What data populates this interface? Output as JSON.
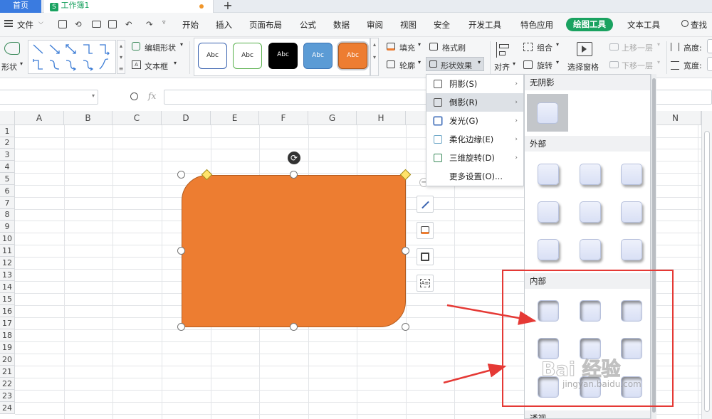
{
  "titlebar": {
    "home_tab": "首页",
    "doc_tab": "工作簿1",
    "doc_icon": "S",
    "new_tab": "+"
  },
  "menubar": {
    "file": "文件",
    "items": [
      "开始",
      "插入",
      "页面布局",
      "公式",
      "数据",
      "审阅",
      "视图",
      "安全",
      "开发工具",
      "特色应用",
      "绘图工具",
      "文本工具"
    ],
    "active": "绘图工具",
    "search": "查找"
  },
  "ribbon": {
    "shape_label": "形状",
    "edit_shape": "编辑形状",
    "text_box": "文本框",
    "styles": [
      "Abc",
      "Abc",
      "Abc",
      "Abc",
      "Abc"
    ],
    "fill": "填充",
    "format_brush": "格式刷",
    "outline": "轮廓",
    "shape_effects": "形状效果",
    "align": "对齐",
    "group": "组合",
    "rotate": "旋转",
    "selection_pane": "选择窗格",
    "bring_forward": "上移一层",
    "send_backward": "下移一层",
    "height": "高度:",
    "width": "宽度:"
  },
  "formulabar": {
    "fx": "fx"
  },
  "grid": {
    "columns": [
      "A",
      "B",
      "C",
      "D",
      "E",
      "F",
      "G",
      "H",
      "N"
    ],
    "rows": [
      "1",
      "2",
      "3",
      "4",
      "5",
      "6",
      "7",
      "8",
      "9",
      "10",
      "11",
      "12",
      "13",
      "14",
      "15",
      "16",
      "17",
      "18",
      "19",
      "20",
      "21",
      "22",
      "23",
      "24"
    ]
  },
  "effects_menu": {
    "items": [
      {
        "label": "阴影(S)",
        "submenu": true
      },
      {
        "label": "倒影(R)",
        "submenu": true
      },
      {
        "label": "发光(G)",
        "submenu": true
      },
      {
        "label": "柔化边缘(E)",
        "submenu": true
      },
      {
        "label": "三维旋转(D)",
        "submenu": true
      },
      {
        "label": "更多设置(O)...",
        "submenu": false
      }
    ],
    "arrow": "›"
  },
  "shadow_panel": {
    "no_shadow": "无阴影",
    "outer": "外部",
    "inner": "内部",
    "perspective": "透视"
  },
  "watermark": {
    "brand": "Bai 经验",
    "url": "jingyan.baidu.com"
  },
  "colors": {
    "shape_fill": "#ed7d31",
    "accent_green": "#1aa260",
    "annotation_red": "#e53935"
  }
}
